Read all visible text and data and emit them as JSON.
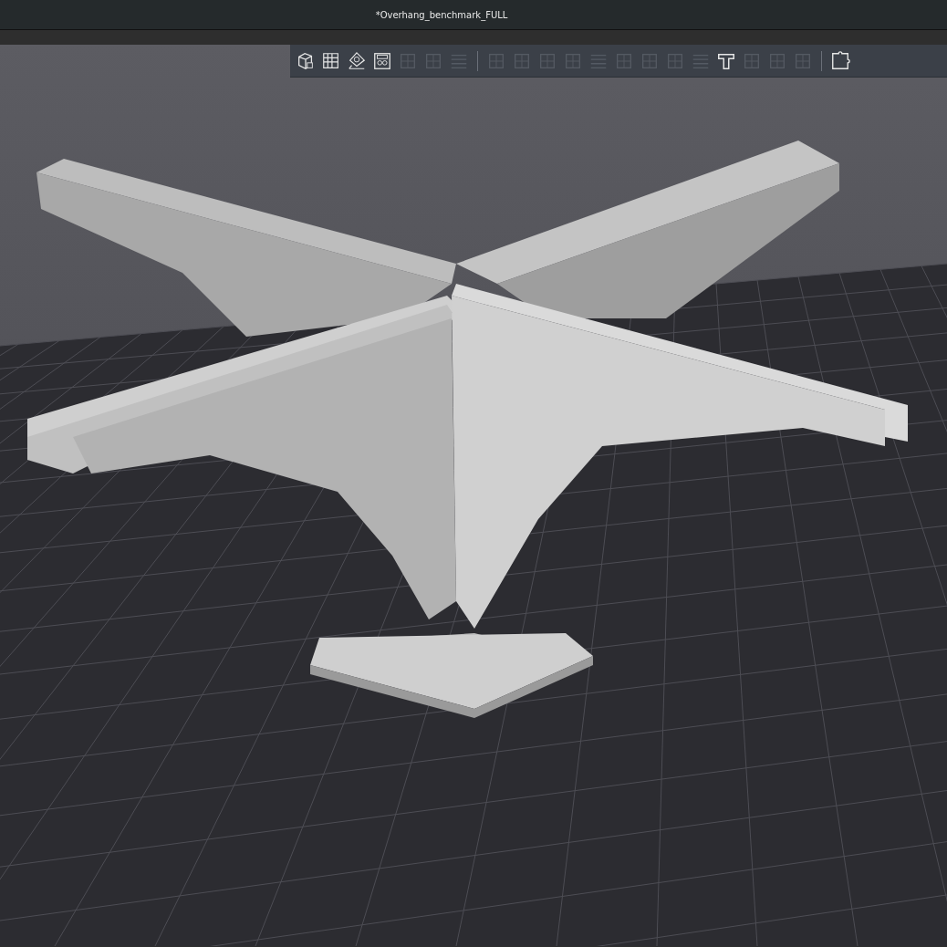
{
  "window": {
    "title": "*Overhang_benchmark_FULL"
  },
  "toolbar": {
    "groups": [
      [
        {
          "kind": "cube",
          "disabled": false
        },
        {
          "kind": "grid",
          "disabled": false
        },
        {
          "kind": "arrange",
          "disabled": false
        },
        {
          "kind": "layout",
          "disabled": false
        },
        {
          "kind": "generic",
          "disabled": true
        },
        {
          "kind": "generic",
          "disabled": true
        },
        {
          "kind": "lines",
          "disabled": true
        }
      ],
      [
        {
          "kind": "generic",
          "disabled": true
        },
        {
          "kind": "generic",
          "disabled": true
        },
        {
          "kind": "generic",
          "disabled": true
        },
        {
          "kind": "generic",
          "disabled": true
        },
        {
          "kind": "lines",
          "disabled": true
        },
        {
          "kind": "generic",
          "disabled": true
        },
        {
          "kind": "generic",
          "disabled": true
        },
        {
          "kind": "generic",
          "disabled": true
        },
        {
          "kind": "lines",
          "disabled": true
        },
        {
          "kind": "text",
          "disabled": false
        },
        {
          "kind": "generic",
          "disabled": true
        },
        {
          "kind": "generic",
          "disabled": true
        },
        {
          "kind": "generic",
          "disabled": true
        }
      ],
      [
        {
          "kind": "puzzle",
          "disabled": false
        }
      ]
    ]
  }
}
